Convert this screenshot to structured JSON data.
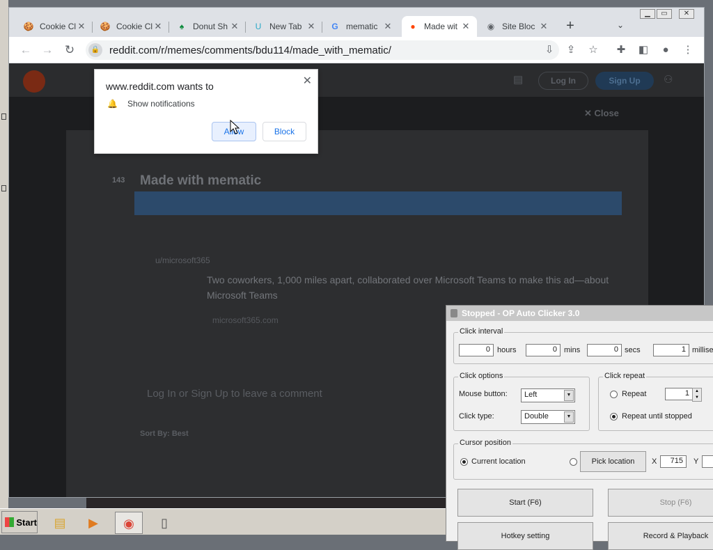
{
  "browser": {
    "tabs": [
      {
        "title": "Cookie Cl",
        "icon": "cookie-icon",
        "active": false
      },
      {
        "title": "Cookie Cl",
        "icon": "cookie-icon",
        "active": false
      },
      {
        "title": "Donut Sh",
        "icon": "donut-icon",
        "active": false
      },
      {
        "title": "New Tab",
        "icon": "newtab-icon",
        "active": false
      },
      {
        "title": "mematic",
        "icon": "google-icon",
        "active": false
      },
      {
        "title": "Made wit",
        "icon": "reddit-icon",
        "active": true
      },
      {
        "title": "Site Bloc",
        "icon": "globe-icon",
        "active": false
      }
    ],
    "new_tab_label": "+",
    "url": "reddit.com/r/memes/comments/bdu114/made_with_mematic/"
  },
  "reddit": {
    "login": "Log In",
    "signup": "Sign Up",
    "close": "Close",
    "votes": "143",
    "post_title": "Made with mematic",
    "ad_text": "Two coworkers, 1,000 miles apart, collaborated over Microsoft Teams to make this ad—about Microsoft Teams",
    "ad_link": "microsoft365.com",
    "promoted_user": "u/microsoft365",
    "login_cta": "Log In or Sign Up to leave a comment",
    "sort_by": "Sort By: Best"
  },
  "notification": {
    "title": "www.reddit.com wants to",
    "permission": "Show notifications",
    "allow": "Allow",
    "block": "Block"
  },
  "autoclicker": {
    "title": "Stopped - OP Auto Clicker 3.0",
    "click_interval_label": "Click interval",
    "hours": "0",
    "hours_label": "hours",
    "mins": "0",
    "mins_label": "mins",
    "secs": "0",
    "secs_label": "secs",
    "millis": "1",
    "millis_label": "millisec",
    "click_options_label": "Click options",
    "mouse_button_label": "Mouse button:",
    "mouse_button": "Left",
    "click_type_label": "Click type:",
    "click_type": "Double",
    "click_repeat_label": "Click repeat",
    "repeat_label": "Repeat",
    "repeat_count": "1",
    "repeat_until_stopped_label": "Repeat until stopped",
    "cursor_position_label": "Cursor position",
    "current_location_label": "Current location",
    "pick_location_label": "Pick location",
    "x_label": "X",
    "x_value": "715",
    "y_label": "Y",
    "start_label": "Start (F6)",
    "stop_label": "Stop (F6)",
    "hotkey_label": "Hotkey setting",
    "record_label": "Record & Playback"
  },
  "taskbar": {
    "start_label": "Start"
  }
}
